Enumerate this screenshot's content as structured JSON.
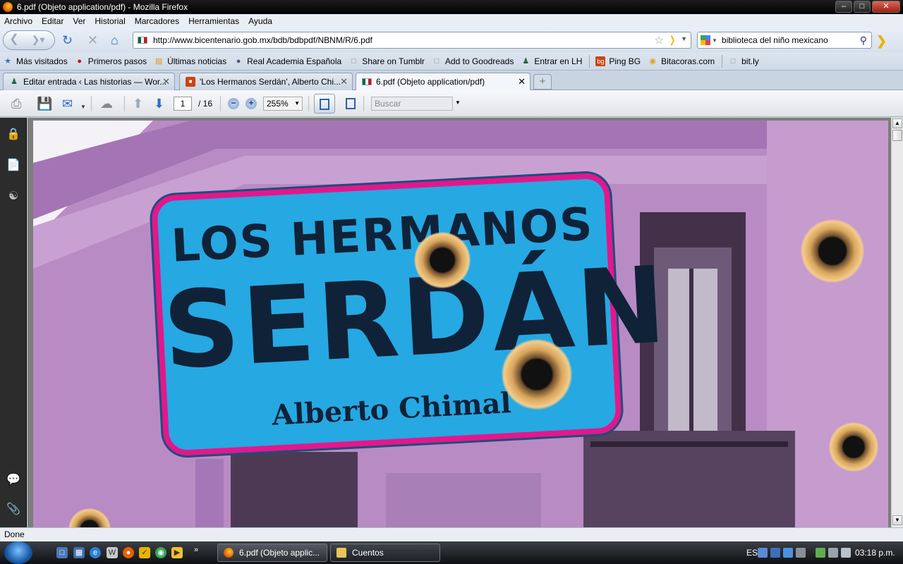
{
  "window": {
    "title": "6.pdf (Objeto application/pdf) - Mozilla Firefox",
    "buttons": [
      "–",
      "□",
      "✕"
    ]
  },
  "menu": [
    "Archivo",
    "Editar",
    "Ver",
    "Historial",
    "Marcadores",
    "Herramientas",
    "Ayuda"
  ],
  "nav": {
    "url": "http://www.bicentenario.gob.mx/bdb/bdbpdf/NBNM/R/6.pdf",
    "search_value": "biblioteca del niño mexicano"
  },
  "bookmarks": [
    {
      "label": "Más visitados",
      "icon": "★"
    },
    {
      "label": "Primeros pasos",
      "icon": "●"
    },
    {
      "label": "Últimas noticias",
      "icon": "▤"
    },
    {
      "label": "Real Academia Española",
      "icon": "●"
    },
    {
      "label": "Share on Tumblr",
      "icon": "□"
    },
    {
      "label": "Add to Goodreads",
      "icon": "□"
    },
    {
      "label": "Entrar en LH",
      "icon": "♟"
    },
    {
      "label": "Ping BG",
      "icon": "bg"
    },
    {
      "label": "Bitacoras.com",
      "icon": "◉"
    },
    {
      "label": "bit.ly",
      "icon": "□"
    }
  ],
  "tabs": [
    {
      "label": "Editar entrada ‹ Las historias — Wor...",
      "active": false
    },
    {
      "label": "'Los Hermanos Serdán', Alberto Chi...",
      "active": false
    },
    {
      "label": "6.pdf (Objeto application/pdf)",
      "active": true
    }
  ],
  "pdf_toolbar": {
    "page_current": "1",
    "page_total": "/ 16",
    "zoom": "255%",
    "find_placeholder": "Buscar"
  },
  "cover": {
    "line1": "LOS HERMANOS",
    "line2": "SERDÁN",
    "author": "Alberto Chimal"
  },
  "status": "Done",
  "taskbar": {
    "tasks": [
      "6.pdf (Objeto applic...",
      "Cuentos"
    ],
    "lang": "ES",
    "clock": "03:18 p.m."
  },
  "colors": {
    "wall": "#b77ebf",
    "sign": "#26a8e2",
    "sign_border": "#e3178c",
    "ink": "#0f2238"
  }
}
